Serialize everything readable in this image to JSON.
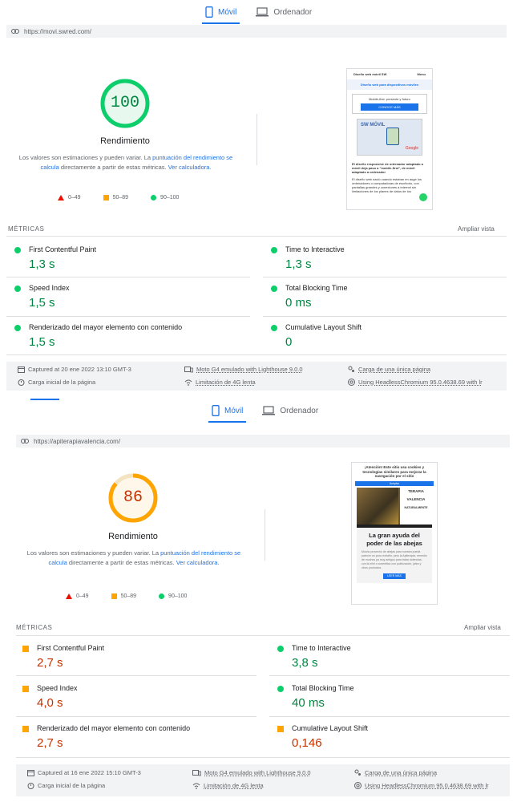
{
  "tabs": {
    "mobile": "Móvil",
    "desktop": "Ordenador"
  },
  "reports": [
    {
      "url": "https://movi.swred.com/",
      "score": "100",
      "score_color": "#0cce6b",
      "score_fraction": 1.0,
      "category": "Rendimiento",
      "desc_pre": "Los valores son estimaciones y pueden variar. La ",
      "desc_link1": "puntuación del rendimiento se calcula",
      "desc_mid": " directamente a partir de estas métricas. ",
      "desc_link2": "Ver calculadora",
      "desc_post": ".",
      "legend": [
        "0–49",
        "50–89",
        "90–100"
      ],
      "metrics_header": "MÉTRICAS",
      "expand": "Ampliar vista",
      "metrics": [
        {
          "title": "First Contentful Paint",
          "value": "1,3 s",
          "status": "good"
        },
        {
          "title": "Time to Interactive",
          "value": "1,3 s",
          "status": "good"
        },
        {
          "title": "Speed Index",
          "value": "1,5 s",
          "status": "good"
        },
        {
          "title": "Total Blocking Time",
          "value": "0 ms",
          "status": "good"
        },
        {
          "title": "Renderizado del mayor elemento con contenido",
          "value": "1,5 s",
          "status": "good"
        },
        {
          "title": "Cumulative Layout Shift",
          "value": "0",
          "status": "good"
        }
      ],
      "footer": {
        "captured": "Captured at 20 ene 2022 13:10 GMT-3",
        "device": "Moto G4 emulado with Lighthouse 9.0.0",
        "session": "Carga de una única página",
        "load": "Carga inicial de la página",
        "throttle": "Limitación de 4G lenta",
        "browser": "Using HeadlessChromium 95.0.4638.69 with lr"
      },
      "screenshot": {
        "header": "Diseño web móvil SW",
        "menu": "Menu",
        "headline": "Diseño web para dispositivos móviles",
        "sub": "Mobile-first: presente y futuro",
        "btn": "CONOCE MÁS",
        "img_text": "SW MÓVIL",
        "img_brand": "Google",
        "p1": "El diseño responsive de ordenador adaptado a móvil deja paso a \"mobile-first\", de móvil adaptado a ordenador",
        "p2": "El diseño web nació cuando estaban en auge los ordenadores o computadoras de escritorio, con pantallas grandes y conexiones a internet sin limitaciones de los planes de datos de los"
      }
    },
    {
      "url": "https://apiterapiavalencia.com/",
      "score": "86",
      "score_color": "#ffa400",
      "score_fraction": 0.86,
      "category": "Rendimiento",
      "desc_pre": "Los valores son estimaciones y pueden variar. La ",
      "desc_link1": "puntuación del rendimiento se calcula",
      "desc_mid": " directamente a partir de estas métricas. ",
      "desc_link2": "Ver calculadora",
      "desc_post": ".",
      "legend": [
        "0–49",
        "50–89",
        "90–100"
      ],
      "metrics_header": "MÉTRICAS",
      "expand": "Ampliar vista",
      "metrics": [
        {
          "title": "First Contentful Paint",
          "value": "2,7 s",
          "status": "average"
        },
        {
          "title": "Time to Interactive",
          "value": "3,8 s",
          "status": "good"
        },
        {
          "title": "Speed Index",
          "value": "4,0 s",
          "status": "average"
        },
        {
          "title": "Total Blocking Time",
          "value": "40 ms",
          "status": "good"
        },
        {
          "title": "Renderizado del mayor elemento con contenido",
          "value": "2,7 s",
          "status": "average"
        },
        {
          "title": "Cumulative Layout Shift",
          "value": "0,146",
          "status": "average"
        }
      ],
      "footer": {
        "captured": "Captured at 16 ene 2022 15:10 GMT-3",
        "device": "Moto G4 emulado with Lighthouse 9.0.0",
        "session": "Carga de una única página",
        "load": "Carga inicial de la página",
        "throttle": "Limitación de 4G lenta",
        "browser": "Using HeadlessChromium 95.0.4638.69 with lr"
      },
      "screenshot": {
        "cookie": "¡Atención! Este sitio usa cookies y tecnologías similares para mejorar la navegación por el sitio",
        "accept": "Aceptar",
        "brand1": "TERAPIA",
        "brand2": "VALENCIA",
        "brand3": "NATURALMENTE",
        "headline": "La gran ayuda del poder de las abejas",
        "body": "Mucho provecho de abejas para nuestra pueda parecer un poco extraño, pero la Apiterapia, remedio de muchos ya muy antiguo para tratar dolencias, con la miel o cosmética con polinización, jalea y otros productos.",
        "btn": "LEER MÁS"
      }
    }
  ]
}
